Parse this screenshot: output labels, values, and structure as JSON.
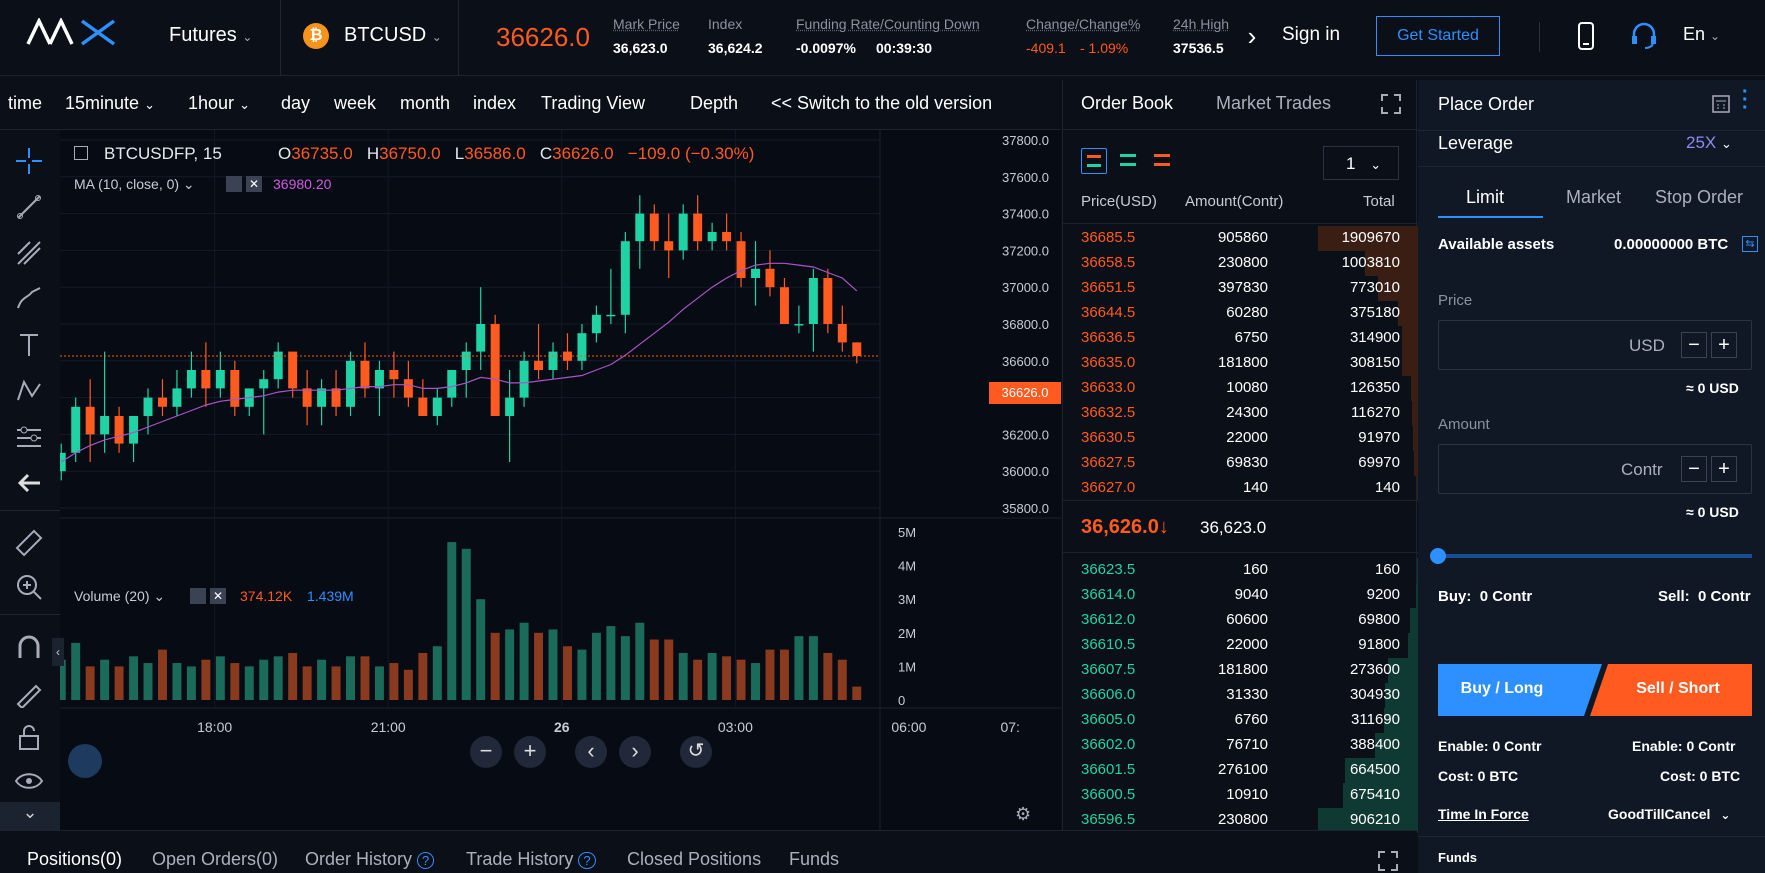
{
  "header": {
    "logo": "AAX",
    "futures_label": "Futures",
    "symbol": "BTCUSD",
    "last_price": "36626.0",
    "mark_price_label": "Mark Price",
    "mark_price": "36,623.0",
    "index_label": "Index",
    "index_value": "36,624.2",
    "funding_label": "Funding Rate/Counting Down",
    "funding_rate": "-0.0097%",
    "funding_countdown": "00:39:30",
    "change_label": "Change/Change%",
    "change_value": "-409.1",
    "change_pct": "- 1.09%",
    "high_label": "24h High",
    "high_value": "37536.5",
    "sign_in": "Sign in",
    "get_started": "Get Started",
    "lang": "En"
  },
  "chart_tabs": {
    "time": "time",
    "m15": "15minute",
    "h1": "1hour",
    "day": "day",
    "week": "week",
    "month": "month",
    "index": "index",
    "trading_view": "Trading View",
    "depth": "Depth",
    "switch_old": "<< Switch to the old version"
  },
  "chart_legend": {
    "symbol": "BTCUSDFP, 15",
    "o_label": "O",
    "o": "36735.0",
    "h_label": "H",
    "h": "36750.0",
    "l_label": "L",
    "l": "36586.0",
    "c_label": "C",
    "c": "36626.0",
    "chg": "−109.0 (−0.30%)",
    "ma_label": "MA (10, close, 0)",
    "ma_value": "36980.20",
    "vol_label": "Volume (20)",
    "vol_a": "374.12K",
    "vol_b": "1.439M",
    "price_tag": "36626.0"
  },
  "chart_data": {
    "type": "candlestick",
    "price_ticks": [
      "37800.0",
      "37600.0",
      "37400.0",
      "37200.0",
      "37000.0",
      "36800.0",
      "36600.0",
      "36400.0",
      "36200.0",
      "36000.0",
      "35800.0"
    ],
    "volume_ticks": [
      "5M",
      "4M",
      "3M",
      "2M",
      "1M",
      "0"
    ],
    "time_ticks": [
      "18:00",
      "21:00",
      "26",
      "03:00",
      "06:00",
      "07:"
    ],
    "ylim": [
      35800,
      37800
    ],
    "ohlc": [
      [
        36000,
        36150,
        35950,
        36100
      ],
      [
        36100,
        36400,
        36050,
        36350
      ],
      [
        36350,
        36500,
        36050,
        36200
      ],
      [
        36200,
        36650,
        36100,
        36300
      ],
      [
        36300,
        36350,
        36100,
        36150
      ],
      [
        36150,
        36300,
        36050,
        36300
      ],
      [
        36300,
        36450,
        36200,
        36400
      ],
      [
        36400,
        36500,
        36300,
        36350
      ],
      [
        36350,
        36550,
        36300,
        36450
      ],
      [
        36450,
        36650,
        36400,
        36550
      ],
      [
        36550,
        36700,
        36350,
        36450
      ],
      [
        36450,
        36650,
        36400,
        36550
      ],
      [
        36550,
        36600,
        36300,
        36350
      ],
      [
        36350,
        36450,
        36300,
        36450
      ],
      [
        36450,
        36550,
        36200,
        36500
      ],
      [
        36500,
        36700,
        36450,
        36650
      ],
      [
        36650,
        36600,
        36400,
        36450
      ],
      [
        36450,
        36550,
        36250,
        36350
      ],
      [
        36350,
        36500,
        36250,
        36450
      ],
      [
        36450,
        36550,
        36300,
        36350
      ],
      [
        36350,
        36650,
        36300,
        36600
      ],
      [
        36600,
        36700,
        36400,
        36450
      ],
      [
        36450,
        36600,
        36300,
        36550
      ],
      [
        36550,
        36650,
        36400,
        36500
      ],
      [
        36500,
        36600,
        36350,
        36400
      ],
      [
        36400,
        36500,
        36300,
        36300
      ],
      [
        36300,
        36450,
        36250,
        36400
      ],
      [
        36400,
        36550,
        36350,
        36550
      ],
      [
        36550,
        36700,
        36400,
        36650
      ],
      [
        36650,
        37000,
        36550,
        36800
      ],
      [
        36800,
        36850,
        36300,
        36300
      ],
      [
        36300,
        36550,
        36050,
        36400
      ],
      [
        36400,
        36650,
        36350,
        36600
      ],
      [
        36600,
        36800,
        36500,
        36550
      ],
      [
        36550,
        36700,
        36500,
        36650
      ],
      [
        36650,
        36750,
        36550,
        36600
      ],
      [
        36600,
        36800,
        36550,
        36750
      ],
      [
        36750,
        36900,
        36700,
        36850
      ],
      [
        36850,
        37100,
        36800,
        36850
      ],
      [
        36850,
        37300,
        36750,
        37250
      ],
      [
        37250,
        37500,
        37100,
        37400
      ],
      [
        37400,
        37450,
        37200,
        37250
      ],
      [
        37250,
        37400,
        37050,
        37200
      ],
      [
        37200,
        37450,
        37150,
        37400
      ],
      [
        37400,
        37500,
        37200,
        37250
      ],
      [
        37250,
        37350,
        37200,
        37300
      ],
      [
        37300,
        37400,
        37200,
        37250
      ],
      [
        37250,
        37300,
        37000,
        37050
      ],
      [
        37050,
        37250,
        36900,
        37100
      ],
      [
        37100,
        37200,
        36950,
        37000
      ],
      [
        37000,
        37050,
        36800,
        36800
      ],
      [
        36800,
        36900,
        36750,
        36800
      ],
      [
        36800,
        37100,
        36650,
        37050
      ],
      [
        37050,
        37100,
        36750,
        36800
      ],
      [
        36800,
        36900,
        36650,
        36700
      ],
      [
        36700,
        36700,
        36586,
        36626
      ]
    ],
    "volume": [
      1.2,
      1.7,
      1.0,
      1.2,
      1.0,
      1.3,
      1.1,
      1.5,
      1.1,
      1.0,
      1.2,
      1.3,
      1.1,
      1.0,
      1.2,
      1.3,
      1.4,
      1.0,
      1.2,
      1.0,
      1.3,
      1.3,
      1.0,
      1.1,
      0.9,
      1.4,
      1.6,
      4.7,
      4.5,
      3.0,
      2.0,
      2.1,
      2.3,
      2.0,
      2.1,
      1.6,
      1.5,
      2.0,
      2.2,
      1.9,
      2.3,
      1.8,
      1.8,
      1.4,
      1.2,
      1.4,
      1.3,
      1.2,
      1.1,
      1.5,
      1.5,
      1.9,
      1.9,
      1.4,
      1.2,
      0.4
    ],
    "ma": [
      36050,
      36100,
      36140,
      36170,
      36190,
      36210,
      36240,
      36270,
      36300,
      36330,
      36360,
      36380,
      36390,
      36400,
      36410,
      36430,
      36440,
      36440,
      36440,
      36440,
      36450,
      36460,
      36460,
      36470,
      36470,
      36450,
      36450,
      36460,
      36480,
      36510,
      36500,
      36480,
      36480,
      36490,
      36500,
      36510,
      36520,
      36550,
      36580,
      36630,
      36690,
      36750,
      36810,
      36880,
      36940,
      37000,
      37050,
      37090,
      37120,
      37130,
      37130,
      37120,
      37110,
      37080,
      37050,
      36980
    ]
  },
  "orderbook": {
    "tab_book": "Order Book",
    "tab_trades": "Market Trades",
    "precision": "1",
    "col_price": "Price(USD)",
    "col_amount": "Amount(Contr)",
    "col_total": "Total",
    "asks": [
      {
        "price": "36685.5",
        "amount": "905860",
        "total": "1909670",
        "depth": 1.0
      },
      {
        "price": "36658.5",
        "amount": "230800",
        "total": "1003810",
        "depth": 0.53
      },
      {
        "price": "36651.5",
        "amount": "397830",
        "total": "773010",
        "depth": 0.4
      },
      {
        "price": "36644.5",
        "amount": "60280",
        "total": "375180",
        "depth": 0.2
      },
      {
        "price": "36636.5",
        "amount": "6750",
        "total": "314900",
        "depth": 0.16
      },
      {
        "price": "36635.0",
        "amount": "181800",
        "total": "308150",
        "depth": 0.16
      },
      {
        "price": "36633.0",
        "amount": "10080",
        "total": "126350",
        "depth": 0.07
      },
      {
        "price": "36632.5",
        "amount": "24300",
        "total": "116270",
        "depth": 0.06
      },
      {
        "price": "36630.5",
        "amount": "22000",
        "total": "91970",
        "depth": 0.05
      },
      {
        "price": "36627.5",
        "amount": "69830",
        "total": "69970",
        "depth": 0.04
      },
      {
        "price": "36627.0",
        "amount": "140",
        "total": "140",
        "depth": 0.01
      }
    ],
    "mid_price": "36,626.0↓",
    "mid_mark": "36,623.0",
    "bids": [
      {
        "price": "36623.5",
        "amount": "160",
        "total": "160",
        "depth": 0.01
      },
      {
        "price": "36614.0",
        "amount": "9040",
        "total": "9200",
        "depth": 0.02
      },
      {
        "price": "36612.0",
        "amount": "60600",
        "total": "69800",
        "depth": 0.08
      },
      {
        "price": "36610.5",
        "amount": "22000",
        "total": "91800",
        "depth": 0.1
      },
      {
        "price": "36607.5",
        "amount": "181800",
        "total": "273600",
        "depth": 0.3
      },
      {
        "price": "36606.0",
        "amount": "31330",
        "total": "304930",
        "depth": 0.33
      },
      {
        "price": "36605.0",
        "amount": "6760",
        "total": "311690",
        "depth": 0.34
      },
      {
        "price": "36602.0",
        "amount": "76710",
        "total": "388400",
        "depth": 0.43
      },
      {
        "price": "36601.5",
        "amount": "276100",
        "total": "664500",
        "depth": 0.73
      },
      {
        "price": "36600.5",
        "amount": "10910",
        "total": "675410",
        "depth": 0.75
      },
      {
        "price": "36596.5",
        "amount": "230800",
        "total": "906210",
        "depth": 1.0
      }
    ]
  },
  "place_order": {
    "title": "Place Order",
    "leverage_label": "Leverage",
    "leverage_value": "25X",
    "tab_limit": "Limit",
    "tab_market": "Market",
    "tab_stop": "Stop Order",
    "assets_label": "Available assets",
    "assets_value": "0.00000000 BTC",
    "price_label": "Price",
    "price_unit": "USD",
    "price_approx": "≈ 0 USD",
    "amount_label": "Amount",
    "amount_unit": "Contr",
    "amount_approx": "≈ 0 USD",
    "buy_label": "Buy:",
    "buy_value": "0 Contr",
    "sell_label": "Sell:",
    "sell_value": "0 Contr",
    "buy_btn": "Buy / Long",
    "sell_btn": "Sell / Short",
    "enable_label": "Enable:",
    "enable_buy": "0  Contr",
    "enable_sell": "0  Contr",
    "cost_label": "Cost:",
    "cost_buy": "0  BTC",
    "cost_sell": "0  BTC",
    "tif_label": "Time In Force",
    "tif_value": "GoodTillCancel",
    "funds_label": "Funds"
  },
  "bottom_tabs": {
    "positions": "Positions(0)",
    "open_orders": "Open Orders(0)",
    "order_history": "Order History",
    "trade_history": "Trade History",
    "closed": "Closed Positions",
    "funds": "Funds"
  },
  "colors": {
    "up": "#1fa589",
    "down": "#ff5a1f",
    "accent": "#2e8fff"
  }
}
